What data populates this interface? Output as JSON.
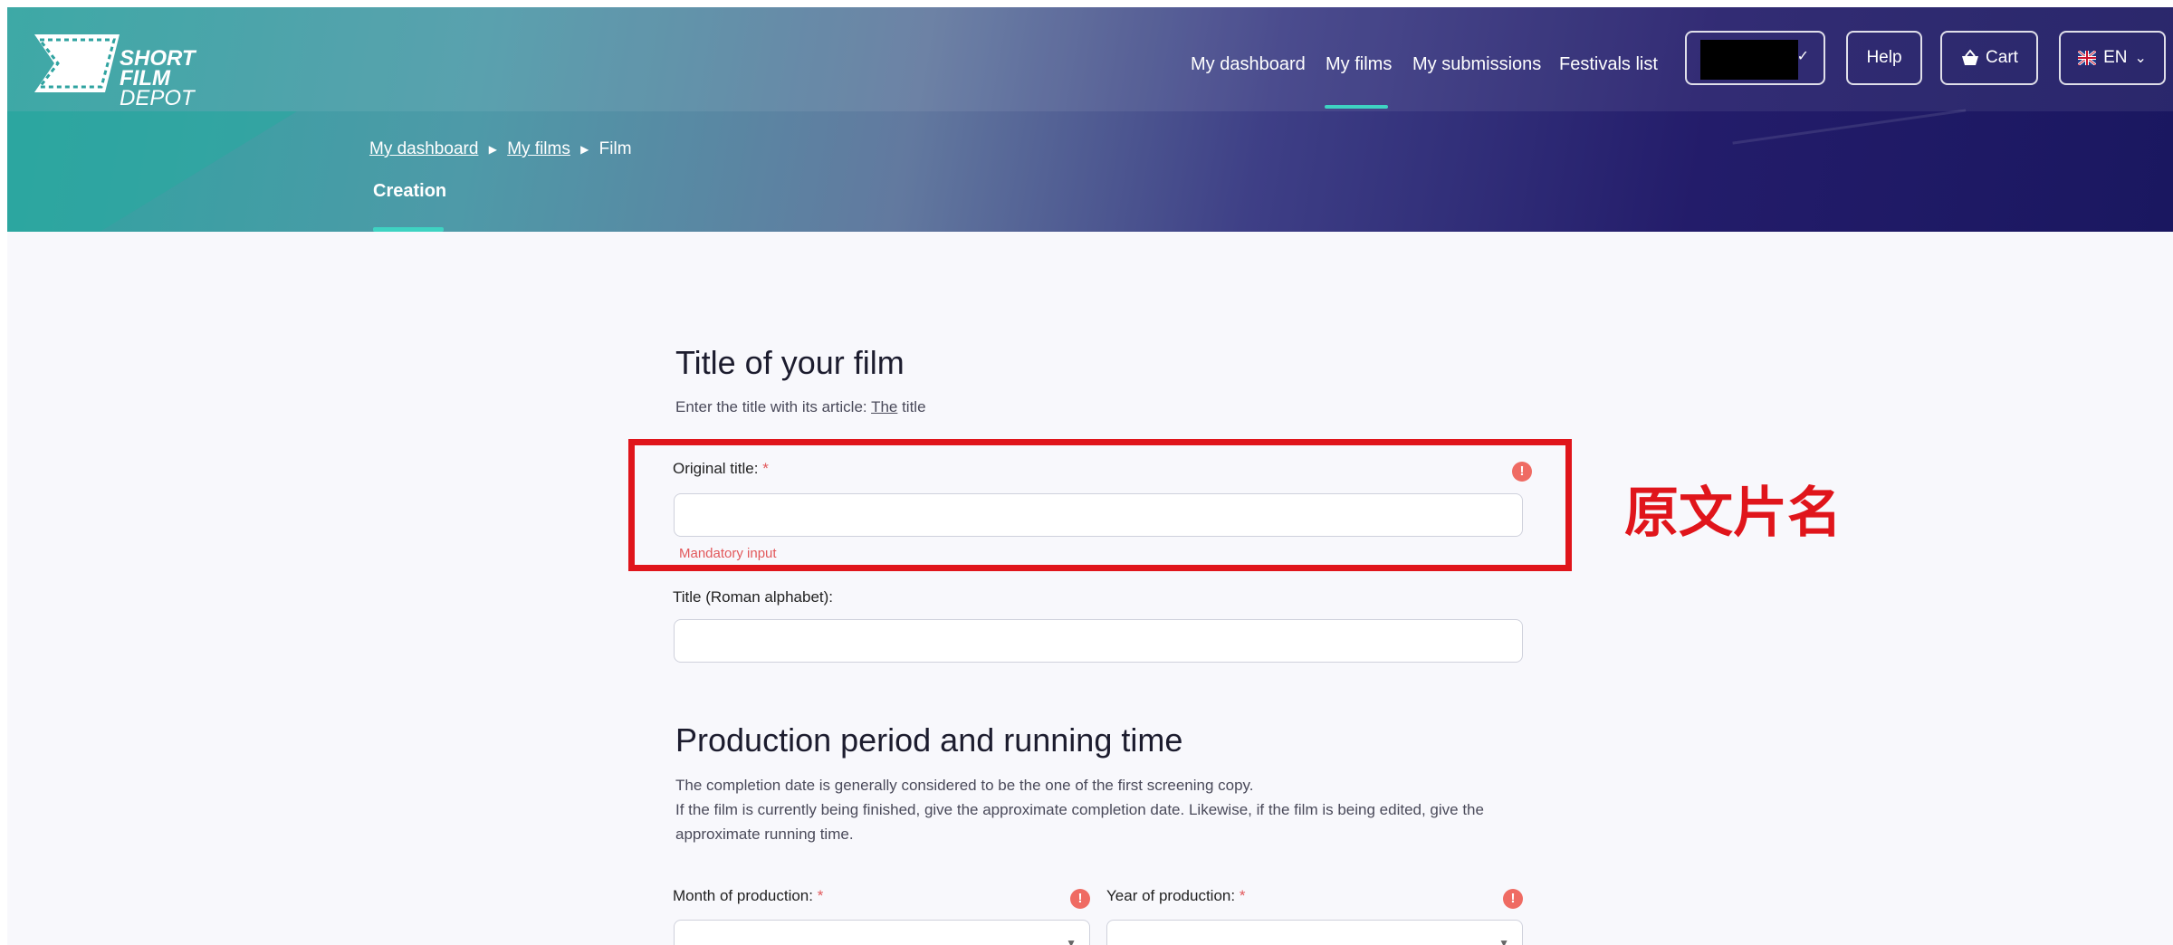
{
  "logo": {
    "line1": "SHORT",
    "line2": "FILM",
    "line3": "DEPOT"
  },
  "nav": {
    "items": [
      {
        "label": "My dashboard"
      },
      {
        "label": "My films"
      },
      {
        "label": "My submissions"
      },
      {
        "label": "Festivals list"
      }
    ],
    "active_index": 1
  },
  "header_buttons": {
    "help": "Help",
    "cart": "Cart",
    "language": "EN"
  },
  "breadcrumb": {
    "items": [
      "My dashboard",
      "My films"
    ],
    "current": "Film"
  },
  "subtab": "Creation",
  "section_title": {
    "heading": "Title of your film",
    "hint_prefix": "Enter the title with its article: ",
    "hint_article": "The",
    "hint_suffix": " title"
  },
  "fields": {
    "original_title": {
      "label": "Original title:",
      "required_mark": "*",
      "value": "",
      "error": "Mandatory input"
    },
    "roman_title": {
      "label": "Title (Roman alphabet):",
      "value": ""
    },
    "month": {
      "label": "Month of production:",
      "required_mark": "*"
    },
    "year": {
      "label": "Year of production:",
      "required_mark": "*"
    }
  },
  "section_production": {
    "heading": "Production period and running time",
    "line1": "The completion date is generally considered to be the one of the first screening copy.",
    "line2": "If the film is currently being finished, give the approximate completion date. Likewise, if the film is being edited, give the approximate running time."
  },
  "annotation": "原文片名",
  "colors": {
    "accent": "#3ed3c2",
    "error": "#ef6b63",
    "highlight": "#e0151b"
  }
}
